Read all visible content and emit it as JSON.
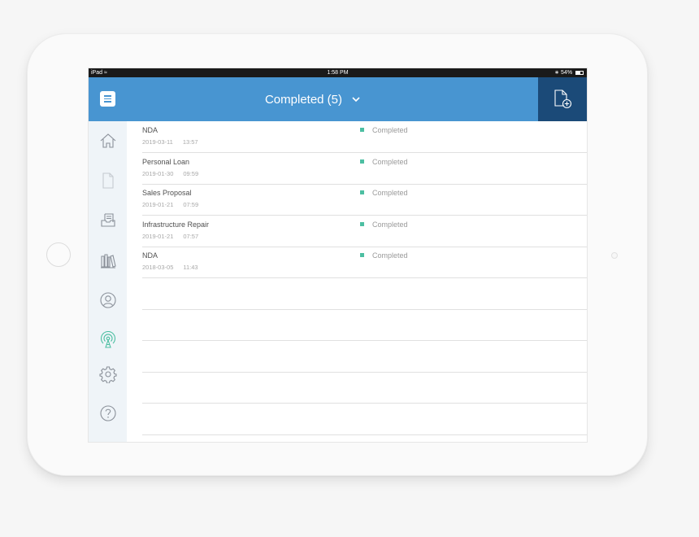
{
  "status_bar": {
    "device": "iPad",
    "time": "1:58 PM",
    "battery": "54%"
  },
  "header": {
    "title": "Completed (5)"
  },
  "sidebar": {
    "items": [
      {
        "icon": "home-icon"
      },
      {
        "icon": "document-icon"
      },
      {
        "icon": "inbox-icon"
      },
      {
        "icon": "library-icon"
      },
      {
        "icon": "user-icon"
      },
      {
        "icon": "broadcast-icon",
        "active": true
      },
      {
        "icon": "gear-icon"
      },
      {
        "icon": "help-icon"
      }
    ]
  },
  "documents": [
    {
      "name": "NDA",
      "date": "2019-03-11",
      "time": "13:57",
      "status": "Completed"
    },
    {
      "name": "Personal Loan",
      "date": "2019-01-30",
      "time": "09:59",
      "status": "Completed"
    },
    {
      "name": "Sales Proposal",
      "date": "2019-01-21",
      "time": "07:59",
      "status": "Completed"
    },
    {
      "name": "Infrastructure Repair",
      "date": "2019-01-21",
      "time": "07:57",
      "status": "Completed"
    },
    {
      "name": "NDA",
      "date": "2018-03-05",
      "time": "11:43",
      "status": "Completed"
    }
  ],
  "colors": {
    "header": "#4895d1",
    "accent_dark": "#1b4a78",
    "status_completed": "#4dbfa2",
    "active_icon": "#4dbfa2"
  }
}
